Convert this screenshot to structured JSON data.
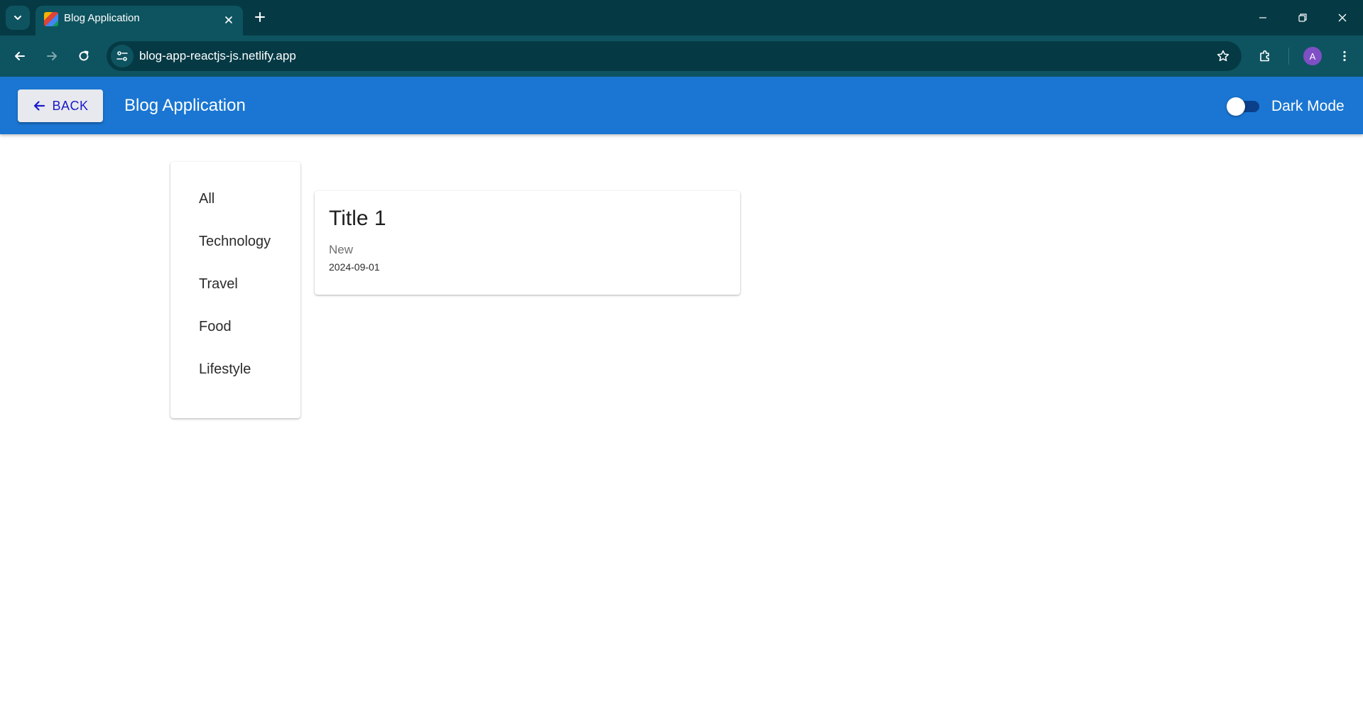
{
  "browser": {
    "tab_title": "Blog Application",
    "url": "blog-app-reactjs-js.netlify.app",
    "profile_initial": "A"
  },
  "appbar": {
    "back_label": "BACK",
    "title": "Blog Application",
    "dark_mode_label": "Dark Mode",
    "dark_mode_on": false
  },
  "categories": [
    "All",
    "Technology",
    "Travel",
    "Food",
    "Lifestyle"
  ],
  "posts": [
    {
      "title": "Title 1",
      "tag": "New",
      "date": "2024-09-01"
    }
  ],
  "colors": {
    "appbar": "#1a76d2",
    "chrome": "#053a45",
    "back_text": "#1a1ac8"
  }
}
